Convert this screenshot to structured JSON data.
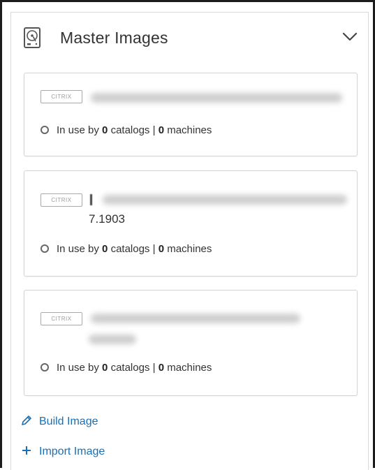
{
  "panel": {
    "title": "Master Images",
    "icon": "disk-image-icon",
    "collapse_icon": "chevron-down-icon"
  },
  "images": [
    {
      "badge": "CITRIX",
      "version": "",
      "status": {
        "prefix": "In use by",
        "catalogs": "0",
        "catalogs_label": "catalogs",
        "separator": "|",
        "machines": "0",
        "machines_label": "machines"
      }
    },
    {
      "badge": "CITRIX",
      "version": "7.1903",
      "status": {
        "prefix": "In use by",
        "catalogs": "0",
        "catalogs_label": "catalogs",
        "separator": "|",
        "machines": "0",
        "machines_label": "machines"
      }
    },
    {
      "badge": "CITRIX",
      "version": "",
      "status": {
        "prefix": "In use by",
        "catalogs": "0",
        "catalogs_label": "catalogs",
        "separator": "|",
        "machines": "0",
        "machines_label": "machines"
      }
    }
  ],
  "actions": {
    "build": {
      "label": "Build Image",
      "icon": "pencil-icon"
    },
    "import": {
      "label": "Import Image",
      "icon": "plus-icon"
    }
  },
  "colors": {
    "link": "#1a6fb5",
    "text": "#333333",
    "border": "#d3d3d3"
  }
}
